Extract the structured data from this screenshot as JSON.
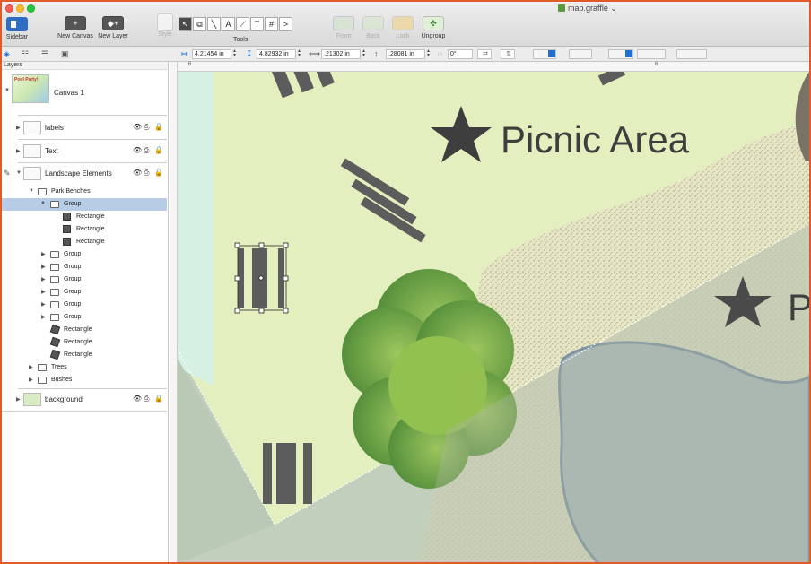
{
  "window": {
    "title": "map.graffle"
  },
  "toolbar": {
    "sidebar_label": "Sidebar",
    "new_canvas_label": "New Canvas",
    "new_layer_label": "New Layer",
    "style_label": "Style",
    "tools_label": "Tools",
    "front_label": "Front",
    "back_label": "Back",
    "lock_label": "Lock",
    "ungroup_label": "Ungroup",
    "tool_glyphs": [
      "↖",
      "⧉",
      "╲",
      "A",
      "⟋",
      "T",
      "#",
      ">"
    ]
  },
  "inspector": {
    "x": "4.21454 in",
    "y": "4.82932 in",
    "w": ".21302 in",
    "h": ".28081 in",
    "rotation": "0°"
  },
  "sidebar": {
    "section_label": "Layers",
    "canvas_name": "Canvas 1",
    "canvas_thumb_text": "Pool Party!",
    "layers": [
      {
        "name": "labels"
      },
      {
        "name": "Text"
      },
      {
        "name": "Landscape Elements"
      },
      {
        "name": "background"
      }
    ],
    "tree": {
      "park_benches": "Park Benches",
      "selected_group": "Group",
      "rect1": "Rectangle",
      "rect2": "Rectangle",
      "rect3": "Rectangle",
      "groups": [
        "Group",
        "Group",
        "Group",
        "Group",
        "Group",
        "Group"
      ],
      "rects": [
        "Rectangle",
        "Rectangle",
        "Rectangle"
      ],
      "trees": "Trees",
      "bushes": "Bushes"
    }
  },
  "canvas": {
    "picnic_label": "Picnic Area",
    "partial_label": "P",
    "ruler_marks": [
      "6",
      "6"
    ]
  },
  "colors": {
    "accent": "#1e6fd0",
    "selection": "#b7cde6",
    "frame": "#e05a2a"
  }
}
